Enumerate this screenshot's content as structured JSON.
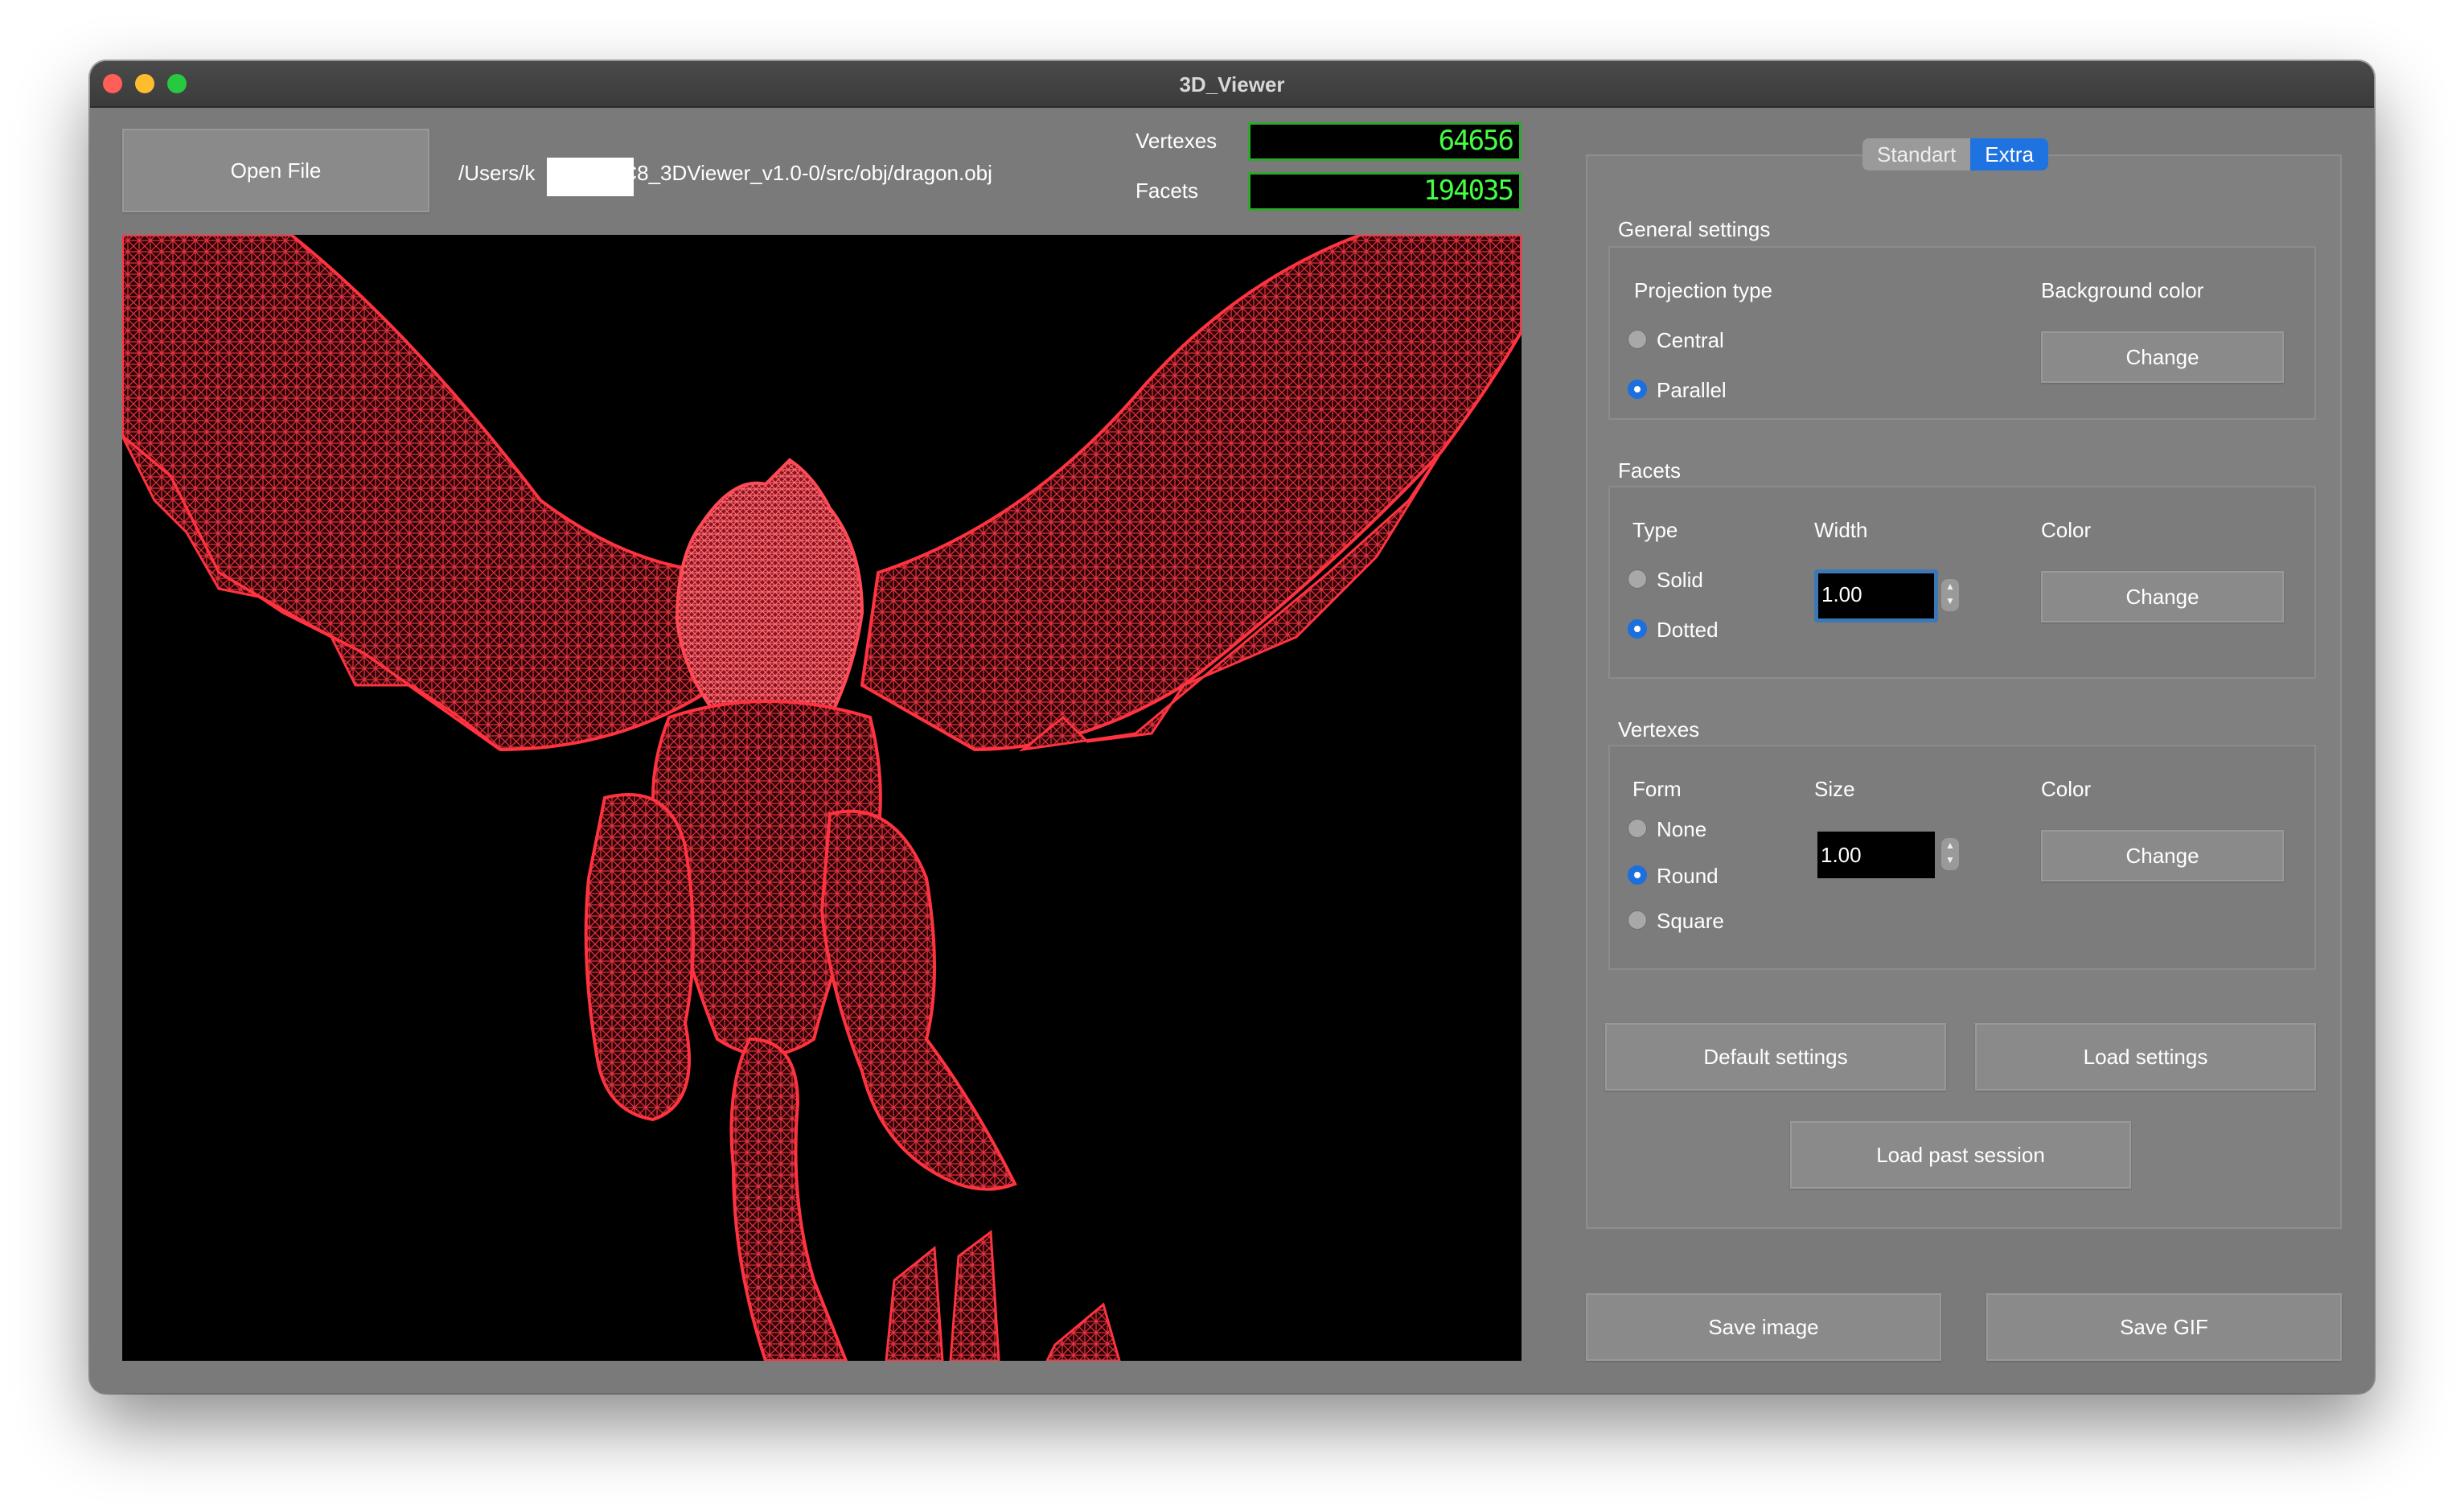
{
  "window": {
    "title": "3D_Viewer"
  },
  "toolbar": {
    "open_file_label": "Open File",
    "path_prefix": "/Users/k",
    "path_suffix": "C8_3DViewer_v1.0-0/src/obj/dragon.obj",
    "vertexes_label": "Vertexes",
    "vertexes_value": "64656",
    "facets_label": "Facets",
    "facets_value": "194035"
  },
  "viewport": {
    "wire_color": "#ff3340",
    "background": "#000000"
  },
  "tabs": {
    "standart": "Standart",
    "extra": "Extra",
    "active": "Extra"
  },
  "general": {
    "title": "General settings",
    "projection_label": "Projection type",
    "central": "Central",
    "parallel": "Parallel",
    "selected": "Parallel",
    "bg_color_label": "Background color",
    "change": "Change"
  },
  "facets": {
    "title": "Facets",
    "type_label": "Type",
    "solid": "Solid",
    "dotted": "Dotted",
    "selected": "Dotted",
    "width_label": "Width",
    "width_value": "1.00",
    "color_label": "Color",
    "change": "Change"
  },
  "vertexes": {
    "title": "Vertexes",
    "form_label": "Form",
    "none": "None",
    "round": "Round",
    "square": "Square",
    "selected": "Round",
    "size_label": "Size",
    "size_value": "1.00",
    "color_label": "Color",
    "change": "Change"
  },
  "actions": {
    "default_settings": "Default settings",
    "load_settings": "Load settings",
    "load_past_session": "Load past session",
    "save_image": "Save image",
    "save_gif": "Save GIF"
  }
}
